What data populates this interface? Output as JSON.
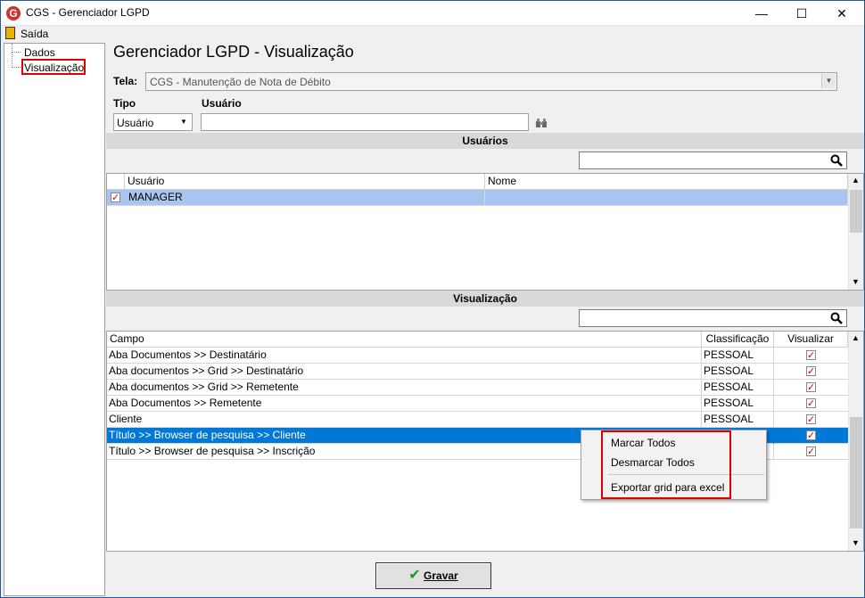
{
  "window": {
    "title": "CGS - Gerenciador LGPD"
  },
  "menu": {
    "exit_label": "Saída"
  },
  "tree": {
    "items": [
      {
        "label": "Dados"
      },
      {
        "label": "Visualização"
      }
    ]
  },
  "page": {
    "title": "Gerenciador LGPD - Visualização"
  },
  "form": {
    "tela_label": "Tela:",
    "tela_value": "CGS - Manutenção de Nota de Débito",
    "tipo_label": "Tipo",
    "tipo_value": "Usuário",
    "usuario_label": "Usuário",
    "usuario_value": ""
  },
  "users_section": {
    "title": "Usuários",
    "search_value": "",
    "columns": [
      "Usuário",
      "Nome"
    ],
    "rows": [
      {
        "usuario": "MANAGER",
        "nome": "",
        "checked": true
      }
    ]
  },
  "view_section": {
    "title": "Visualização",
    "search_value": "",
    "columns": [
      "Campo",
      "Classificação",
      "Visualizar"
    ],
    "rows": [
      {
        "campo": "Aba Documentos >> Destinatário",
        "classificacao": "PESSOAL",
        "visualizar": true
      },
      {
        "campo": "Aba documentos >> Grid >> Destinatário",
        "classificacao": "PESSOAL",
        "visualizar": true
      },
      {
        "campo": "Aba documentos >> Grid >> Remetente",
        "classificacao": "PESSOAL",
        "visualizar": true
      },
      {
        "campo": "Aba Documentos >> Remetente",
        "classificacao": "PESSOAL",
        "visualizar": true
      },
      {
        "campo": "Cliente",
        "classificacao": "PESSOAL",
        "visualizar": true
      },
      {
        "campo": "Título >> Browser de pesquisa >> Cliente",
        "classificacao": "",
        "visualizar": true
      },
      {
        "campo": "Título >> Browser de pesquisa >> Inscrição",
        "classificacao": "",
        "visualizar": true
      }
    ]
  },
  "context_menu": {
    "items": [
      {
        "label": "Marcar Todos"
      },
      {
        "label": "Desmarcar Todos"
      },
      {
        "label": "Exportar grid para excel"
      }
    ]
  },
  "footer": {
    "save_label": "Gravar"
  },
  "colors": {
    "selection": "#0078d7",
    "highlight_box": "#e00000",
    "section_bar": "#d9d9d9"
  }
}
